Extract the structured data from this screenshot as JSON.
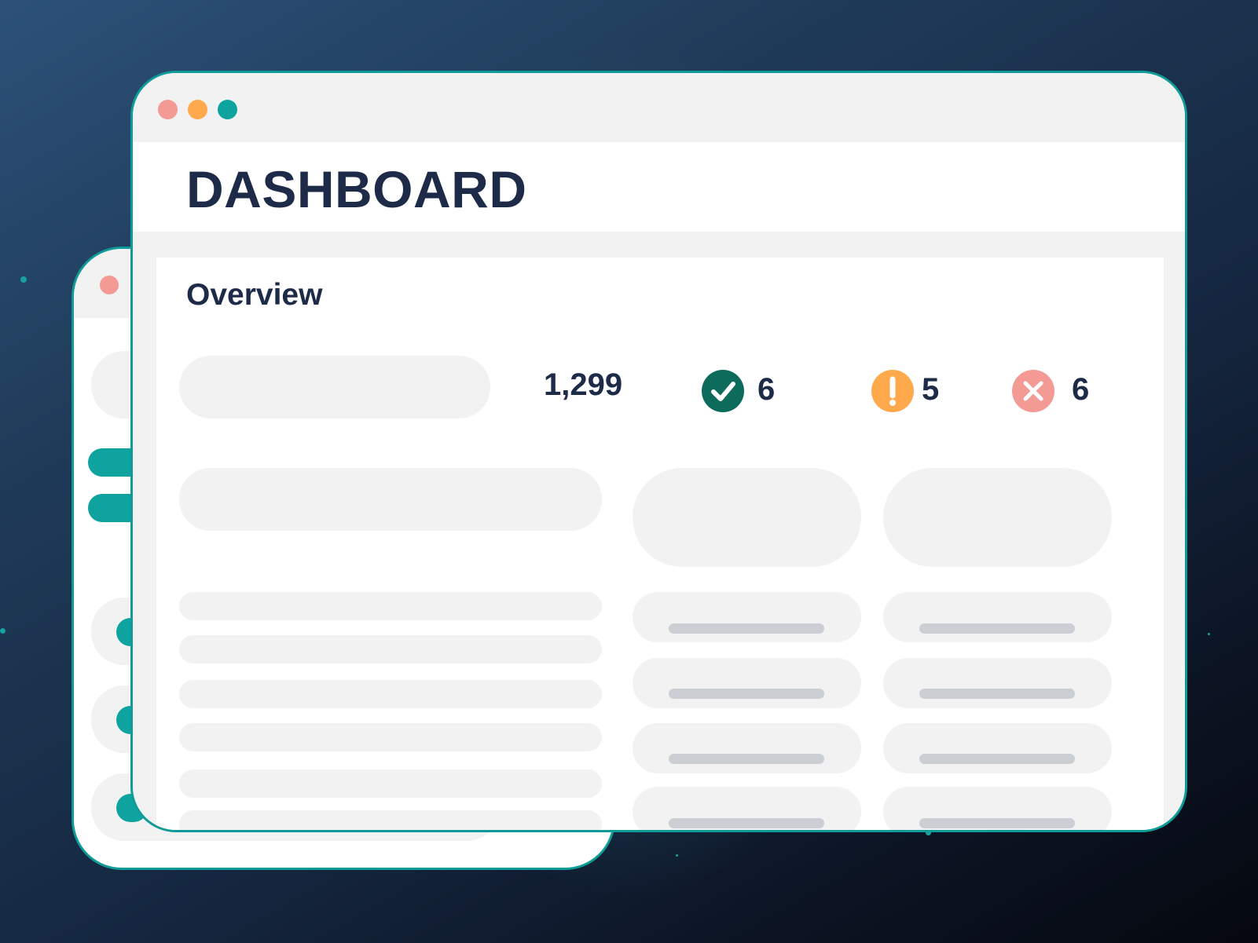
{
  "window": {
    "title": "DASHBOARD",
    "traffic_lights": {
      "close": "#f39a94",
      "minimize": "#ffa94d",
      "maximize": "#0fa3a0"
    }
  },
  "overview": {
    "heading": "Overview",
    "total": "1,299",
    "stats": [
      {
        "icon": "check-circle-icon",
        "color": "#0c6b5b",
        "count": "6"
      },
      {
        "icon": "exclamation-circle-icon",
        "color": "#ffa94d",
        "count": "5"
      },
      {
        "icon": "x-circle-icon",
        "color": "#f39a94",
        "count": "6"
      }
    ]
  },
  "colors": {
    "accent": "#0f9c98",
    "text": "#1d2b48",
    "placeholder": "#f1f2f1"
  }
}
